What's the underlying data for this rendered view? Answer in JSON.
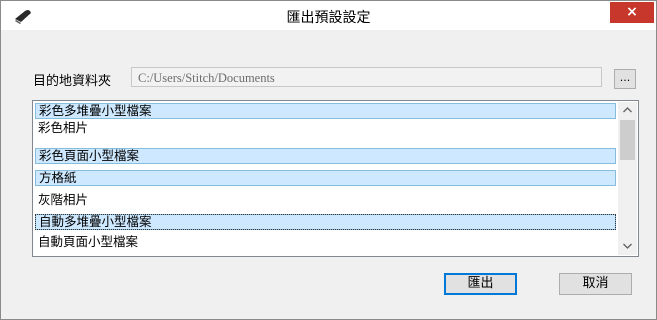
{
  "window": {
    "title": "匯出預設設定",
    "close_label": "×"
  },
  "folder": {
    "label": "目的地資料夾",
    "path": "C:/Users/Stitch/Documents",
    "browse_label": "..."
  },
  "list": {
    "items": [
      {
        "label": "彩色多堆疊小型檔案",
        "selected": true
      },
      {
        "label": "彩色相片",
        "selected": false
      },
      {
        "label": "彩色頁面小型檔案",
        "selected": true
      },
      {
        "label": "方格紙",
        "selected": true
      },
      {
        "label": "灰階相片",
        "selected": false
      },
      {
        "label": "自動多堆疊小型檔案",
        "selected": true
      },
      {
        "label": "自動頁面小型檔案",
        "selected": false
      }
    ],
    "scroll_up": "^",
    "scroll_down": "v"
  },
  "buttons": {
    "export_label": "匯出",
    "cancel_label": "取消"
  },
  "colors": {
    "close_button": "#c7372b",
    "selection_fill": "#cde8ff",
    "selection_border": "#86bddd",
    "default_button_border": "#0078d7"
  },
  "icons": {
    "app": "scanner-icon",
    "close": "close-icon"
  }
}
